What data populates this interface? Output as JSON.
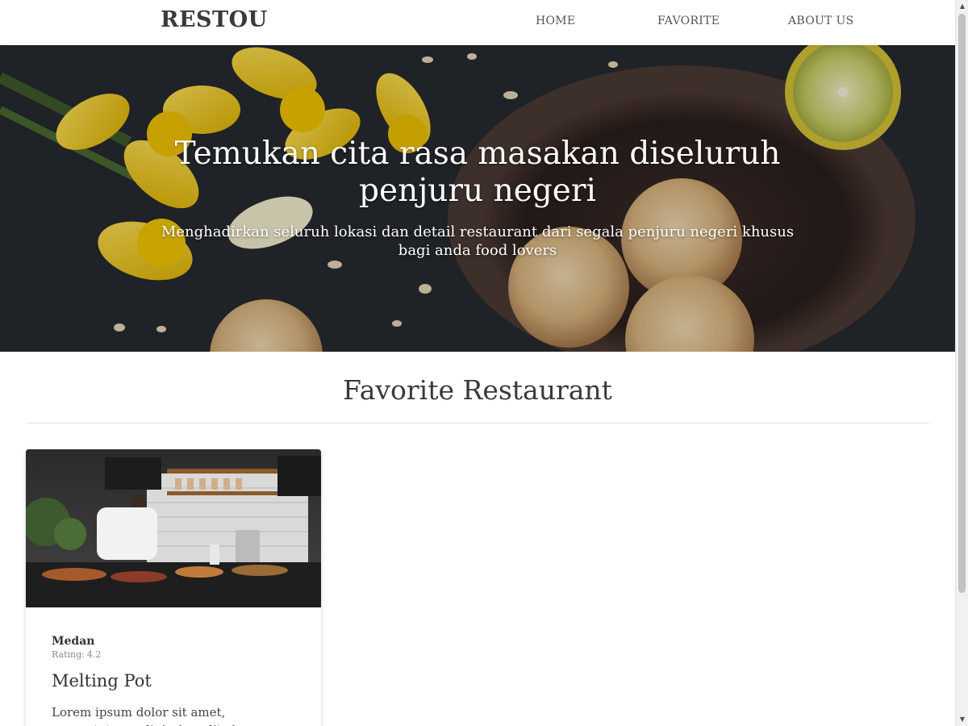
{
  "header": {
    "brand": "RESTOU",
    "nav": [
      {
        "label": "HOME"
      },
      {
        "label": "FAVORITE"
      },
      {
        "label": "ABOUT US"
      }
    ]
  },
  "hero": {
    "title": "Temukan cita rasa masakan diseluruh penjuru negeri",
    "subtitle": "Menghadirkan seluruh lokasi dan detail restaurant dari segala penjuru negeri khusus bagi anda food lovers"
  },
  "main": {
    "section_title": "Favorite Restaurant",
    "restaurants": [
      {
        "city": "Medan",
        "rating_label": "Rating:",
        "rating": "4.2",
        "name": "Melting Pot",
        "description": "Lorem ipsum dolor sit amet, consectetuer adipiscing elit. Aenean commodo ligula eget dolor."
      }
    ]
  },
  "scrollbar": {
    "up_icon": "triangle-up-icon",
    "down_icon": "triangle-down-icon"
  }
}
